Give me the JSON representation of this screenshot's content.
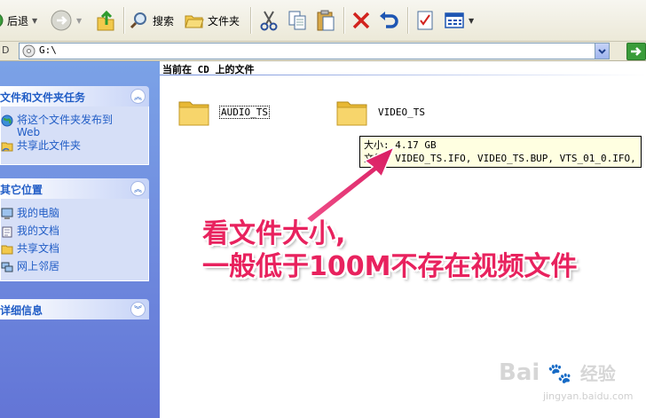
{
  "toolbar": {
    "back_label": "后退",
    "search_label": "搜索",
    "folders_label": "文件夹"
  },
  "address": {
    "label": "D",
    "value": "G:\\"
  },
  "tasks": {
    "file_tasks_title": "文件和文件夹任务",
    "publish_line1": "将这个文件夹发布到",
    "publish_line2": "Web",
    "share_label": "共享此文件夹",
    "other_places_title": "其它位置",
    "places": [
      "我的电脑",
      "我的文档",
      "共享文档",
      "网上邻居"
    ],
    "details_title": "详细信息"
  },
  "content": {
    "group_title": "当前在 CD 上的文件",
    "folders": [
      "AUDIO_TS",
      "VIDEO_TS"
    ],
    "tooltip_line1": "大小: 4.17 GB",
    "tooltip_line2": "文件: VIDEO_TS.IFO, VIDEO_TS.BUP, VTS_01_0.IFO, ..."
  },
  "annotation": {
    "line1": "看文件大小,",
    "line2": "一般低于100M不存在视频文件"
  },
  "watermark": {
    "brand": "Bai",
    "brand2": "经验",
    "site": "jingyan.baidu.com"
  },
  "colors": {
    "annotation": "#e8225e",
    "panel_title": "#215dc6",
    "left_pane": "#6375d6"
  }
}
